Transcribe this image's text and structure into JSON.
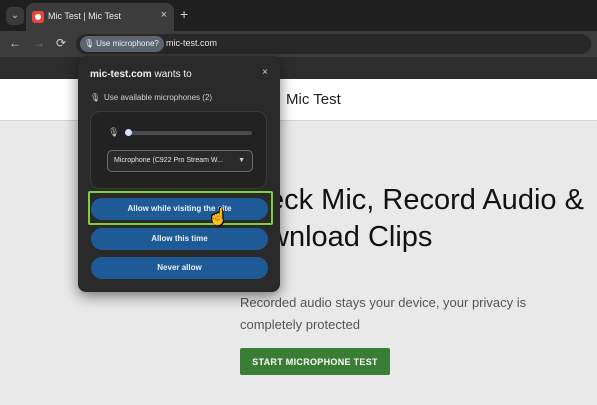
{
  "browser": {
    "tab_search_icon": "chevron-down-icon",
    "tab": {
      "title": "Mic Test | Mic Test",
      "close": "×"
    },
    "new_tab": "+",
    "nav": {
      "back": "←",
      "forward": "→",
      "reload": "⟳"
    },
    "permission_chip": {
      "icon": "microphone-icon",
      "label": "Use microphone?"
    },
    "url": "mic-test.com"
  },
  "page": {
    "site_name": "Mic Test",
    "headline": "eck Mic, Record Audio &\nwnload Clips",
    "subtext": "Recorded audio stays your device, your privacy is completely protected",
    "start_button": "START MICROPHONE TEST"
  },
  "popup": {
    "site": "mic-test.com",
    "wants_to": "wants to",
    "close": "×",
    "use_text": "Use available microphones (2)",
    "mic_level": 0.04,
    "selected_microphone": "Microphone (C922 Pro Stream W...",
    "buttons": {
      "allow_while_visiting": "Allow while visiting the site",
      "allow_this_time": "Allow this time",
      "never_allow": "Never allow"
    }
  },
  "colors": {
    "permission_button": "#1e5a95",
    "highlight": "#7dd13b",
    "start_button": "#3a7d34"
  }
}
